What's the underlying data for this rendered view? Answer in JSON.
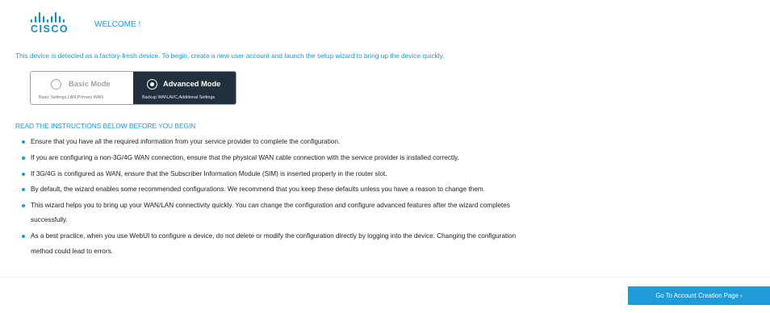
{
  "brand": {
    "logo_text": "CISCO",
    "color": "#0a8fc9"
  },
  "header": {
    "welcome": "WELCOME !"
  },
  "intro": "This device is detected as a factory-fresh device. To begin, create a new user account and launch the setup wizard to bring up the device quickly.",
  "modes": {
    "selected": "advanced",
    "basic": {
      "title": "Basic Mode",
      "subtitle": "Basic Settings,LAN,Primary WAN"
    },
    "advanced": {
      "title": "Advanced Mode",
      "subtitle": "Backup WAN,AVC,Additional Settings"
    }
  },
  "instructions": {
    "heading": "READ THE INSTRUCTIONS BELOW BEFORE YOU BEGIN",
    "items": [
      {
        "text": "Ensure that you have all the required information from your service provider to complete the configuration."
      },
      {
        "text": "If you are configuring a non-3G/4G WAN connection, ensure that the physical WAN cable connection with the service provider is installed correctly."
      },
      {
        "text": "If 3G/4G is configured as WAN, ensure that the Subscriber Information Module (SIM) is inserted properly in the router slot."
      },
      {
        "text": "By default, the wizard enables some recommended configurations. We recommend that you keep these defaults unless you have a reason to change them."
      },
      {
        "text": "This wizard helps you to bring up your WAN/LAN connectivity quickly. You can change the configuration and configure advanced features after the wizard completes",
        "cont": "successfully."
      },
      {
        "text": "As a best practice, when you use WebUI to configure a device, do not delete or modify the configuration directly by logging into the device. Changing the configuration",
        "cont": "method could lead to errors."
      }
    ]
  },
  "footer": {
    "button_label": "Go To Account Creation Page ›"
  },
  "colors": {
    "accent": "#1a9ad6",
    "dark": "#21303c",
    "button": "#1f9bd7"
  }
}
